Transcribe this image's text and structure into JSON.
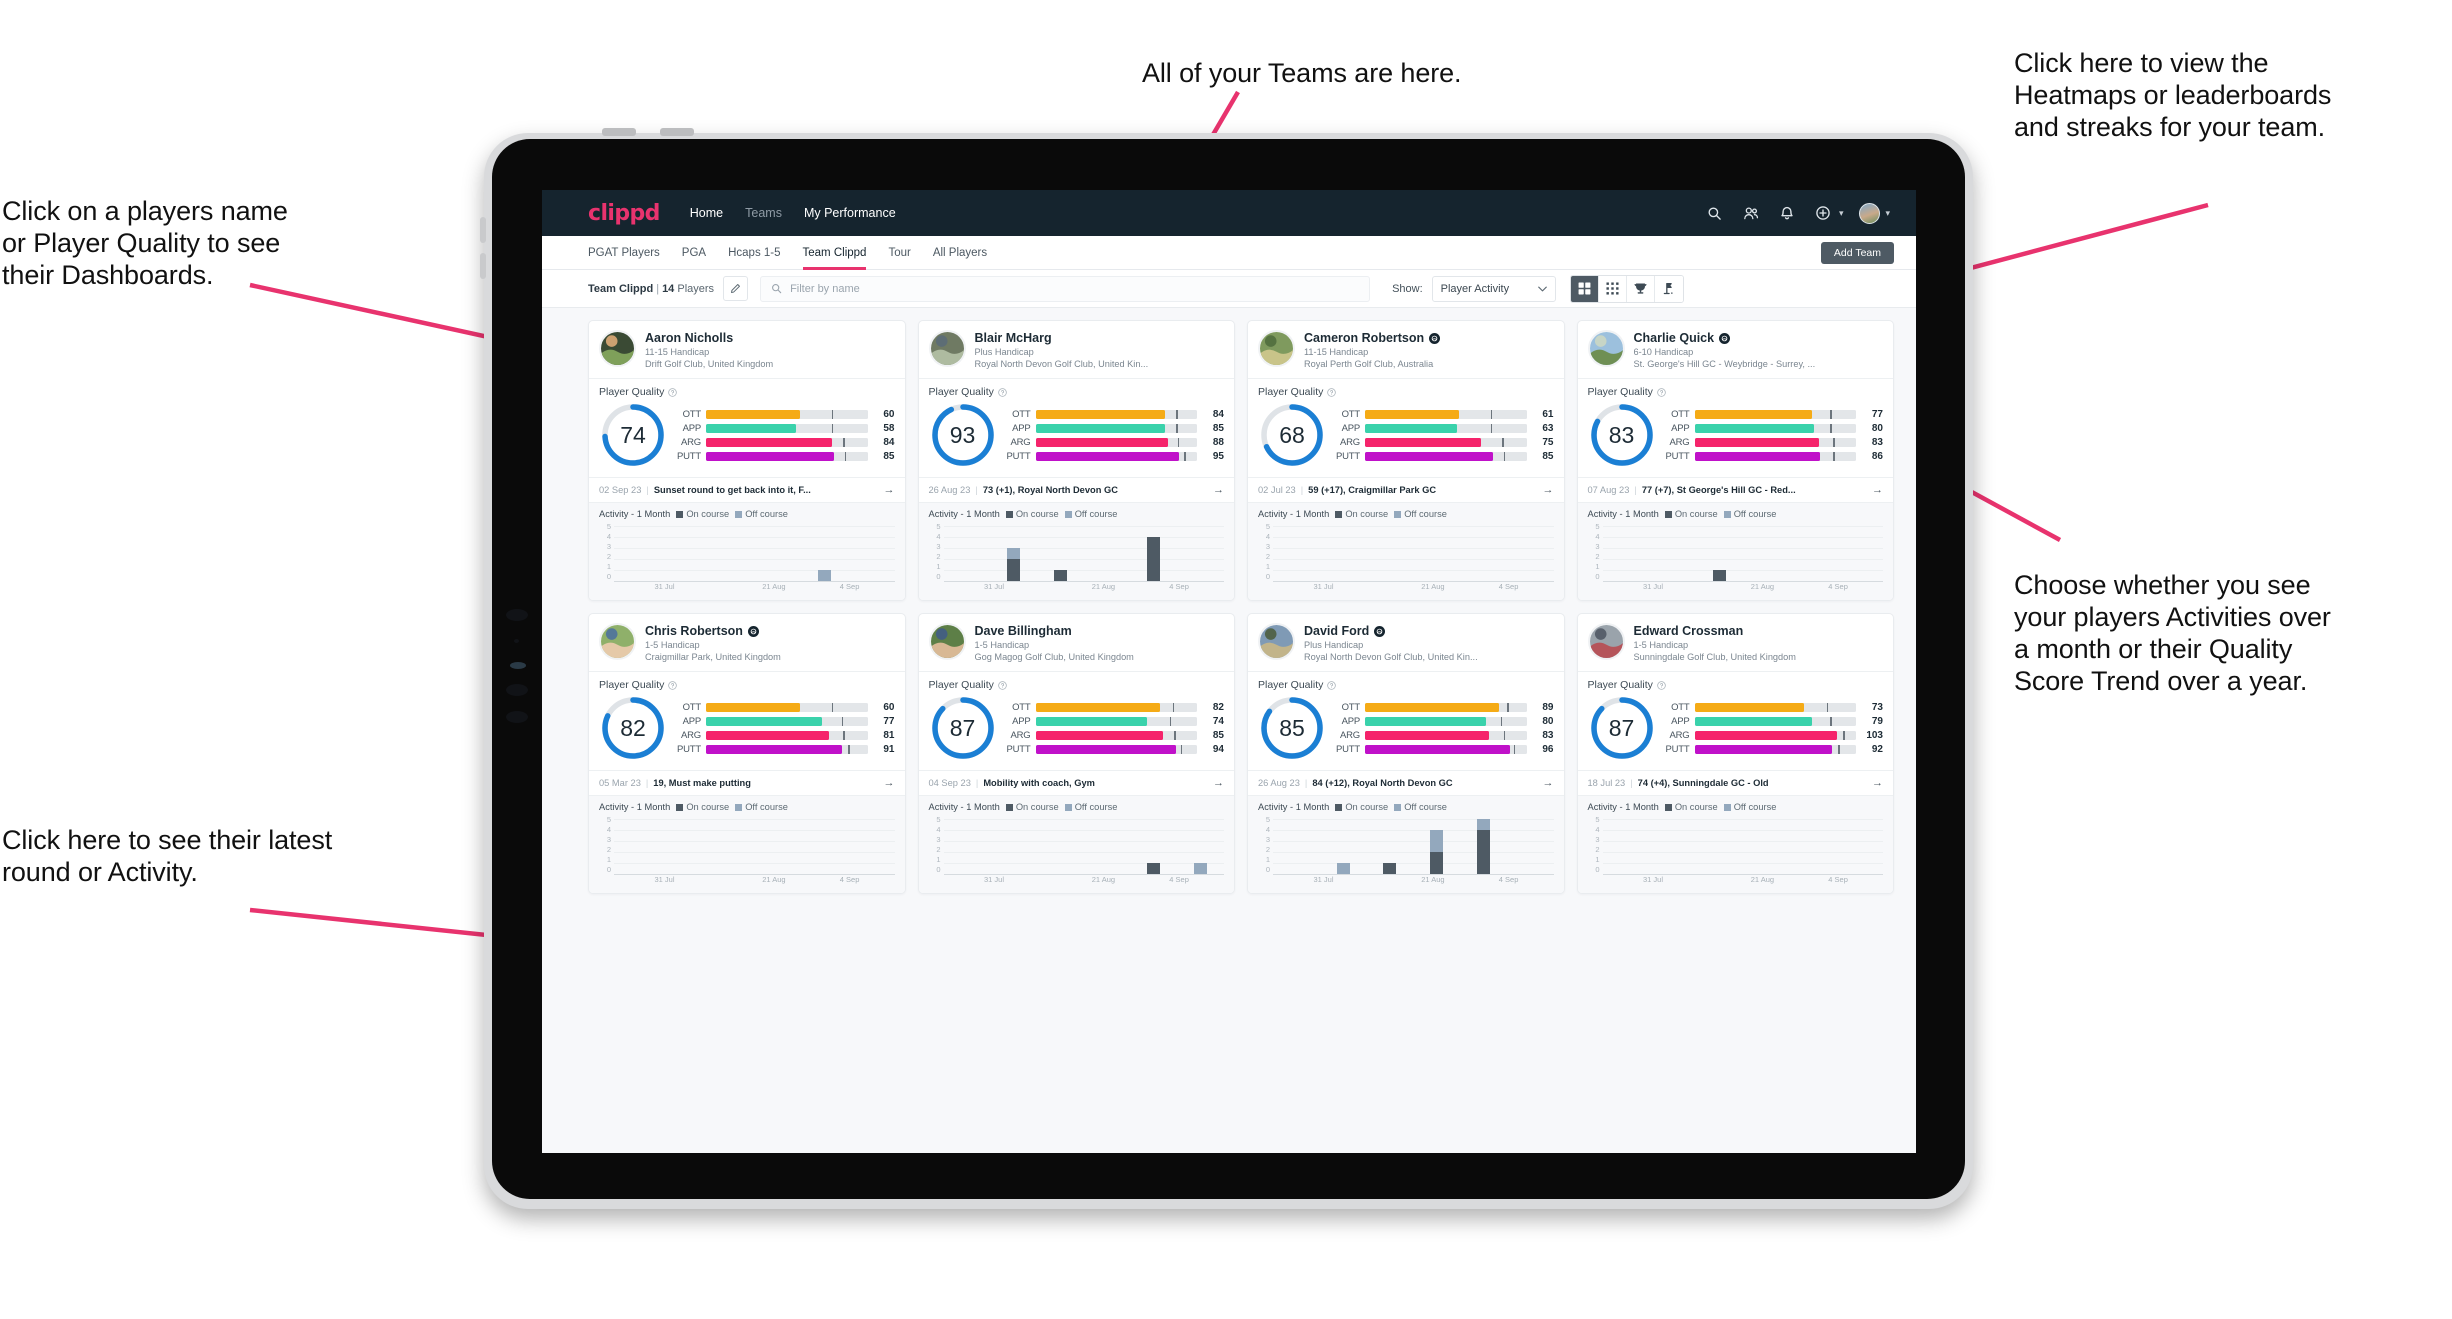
{
  "annotations": [
    {
      "id": "teams",
      "text": "All of your Teams are here."
    },
    {
      "id": "heatmaps",
      "text": "Click here to view the\nHeatmaps or leaderboards\nand streaks for your team."
    },
    {
      "id": "dashboards",
      "text": "Click on a players name\nor Player Quality to see\ntheir Dashboards."
    },
    {
      "id": "activity-choice",
      "text": "Choose whether you see\nyour players Activities over\na month or their Quality\nScore Trend over a year."
    },
    {
      "id": "latest-round",
      "text": "Click here to see their latest\nround or Activity."
    }
  ],
  "accent_pink": "#e8336e",
  "navbar": {
    "brand": "clippd",
    "links": [
      {
        "label": "Home",
        "state": "active"
      },
      {
        "label": "Teams",
        "state": "dim"
      },
      {
        "label": "My Performance",
        "state": "active"
      }
    ],
    "icons": [
      "search-icon",
      "people-icon",
      "bell-icon",
      "plus-circle-icon",
      "avatar"
    ]
  },
  "tabs": {
    "items": [
      "PGAT Players",
      "PGA",
      "Hcaps 1-5",
      "Team Clippd",
      "Tour",
      "All Players"
    ],
    "selected": "Team Clippd",
    "add_team_label": "Add Team"
  },
  "filterbar": {
    "team_name": "Team Clippd",
    "separator": "|",
    "player_count": "14",
    "player_word": "Players",
    "edit_icon": "pencil-icon",
    "search_placeholder": "Filter by name",
    "show_label": "Show:",
    "show_value": "Player Activity",
    "view_modes": [
      {
        "name": "grid-view-icon",
        "active": true
      },
      {
        "name": "dense-grid-view-icon",
        "active": false
      },
      {
        "name": "trophy-view-icon",
        "active": false
      },
      {
        "name": "course-flag-view-icon",
        "active": false
      }
    ]
  },
  "card_labels": {
    "player_quality": "Player Quality",
    "help_icon": "help-circle-icon",
    "activity_title": "Activity - 1 Month",
    "legend_on": "On course",
    "legend_off": "Off course",
    "arrow": "→"
  },
  "metric_colors": {
    "OTT": "#f5ab16",
    "APP": "#3ad2ab",
    "ARG": "#f5236b",
    "PUTT": "#c011c9",
    "ring": "#1b7fd4",
    "ring_track": "#dfe3e7"
  },
  "chart_axes": {
    "y_ticks": [
      "5",
      "4",
      "3",
      "2",
      "1",
      "0"
    ],
    "y_max": 5,
    "x_ticks": [
      "31 Jul",
      "21 Aug",
      "4 Sep"
    ],
    "x_tick_pos": [
      18,
      57,
      84
    ]
  },
  "players": [
    {
      "name": "Aaron Nicholls",
      "verified": false,
      "handicap": "11-15 Handicap",
      "club": "Drift Golf Club, United Kingdom",
      "quality": 74,
      "metrics": [
        {
          "label": "OTT",
          "value": 60,
          "fill": 58,
          "tick": 78
        },
        {
          "label": "APP",
          "value": 58,
          "fill": 56,
          "tick": 78
        },
        {
          "label": "ARG",
          "value": 84,
          "fill": 78,
          "tick": 85
        },
        {
          "label": "PUTT",
          "value": 85,
          "fill": 79,
          "tick": 86
        }
      ],
      "last_date": "02 Sep 23",
      "last_text": "Sunset round to get back into it, F...",
      "activity": [
        {
          "on": 0,
          "off": 0
        },
        {
          "on": 0,
          "off": 0
        },
        {
          "on": 0,
          "off": 0
        },
        {
          "on": 0,
          "off": 0
        },
        {
          "on": 0,
          "off": 1
        },
        {
          "on": 0,
          "off": 0
        }
      ],
      "avatar_colors": [
        "#3a4a34",
        "#7fa05a",
        "#e8b07c"
      ]
    },
    {
      "name": "Blair McHarg",
      "verified": false,
      "handicap": "Plus Handicap",
      "club": "Royal North Devon Golf Club, United Kin...",
      "quality": 93,
      "metrics": [
        {
          "label": "OTT",
          "value": 84,
          "fill": 80,
          "tick": 87
        },
        {
          "label": "APP",
          "value": 85,
          "fill": 80,
          "tick": 87
        },
        {
          "label": "ARG",
          "value": 88,
          "fill": 82,
          "tick": 88
        },
        {
          "label": "PUTT",
          "value": 95,
          "fill": 89,
          "tick": 92
        }
      ],
      "last_date": "26 Aug 23",
      "last_text": "73 (+1), Royal North Devon GC",
      "activity": [
        {
          "on": 0,
          "off": 0
        },
        {
          "on": 2,
          "off": 1
        },
        {
          "on": 1,
          "off": 0
        },
        {
          "on": 0,
          "off": 0
        },
        {
          "on": 4,
          "off": 0
        },
        {
          "on": 0,
          "off": 0
        }
      ],
      "avatar_colors": [
        "#6f7a63",
        "#aebba0",
        "#5a6b78"
      ]
    },
    {
      "name": "Cameron Robertson",
      "verified": true,
      "handicap": "11-15 Handicap",
      "club": "Royal Perth Golf Club, Australia",
      "quality": 68,
      "metrics": [
        {
          "label": "OTT",
          "value": 61,
          "fill": 58,
          "tick": 78
        },
        {
          "label": "APP",
          "value": 63,
          "fill": 57,
          "tick": 78
        },
        {
          "label": "ARG",
          "value": 75,
          "fill": 72,
          "tick": 85
        },
        {
          "label": "PUTT",
          "value": 85,
          "fill": 79,
          "tick": 86
        }
      ],
      "last_date": "02 Jul 23",
      "last_text": "59 (+17), Craigmillar Park GC",
      "activity": [
        {
          "on": 0,
          "off": 0
        },
        {
          "on": 0,
          "off": 0
        },
        {
          "on": 0,
          "off": 0
        },
        {
          "on": 0,
          "off": 0
        },
        {
          "on": 0,
          "off": 0
        },
        {
          "on": 0,
          "off": 0
        }
      ],
      "avatar_colors": [
        "#7f9a5e",
        "#c9c489",
        "#4e6b3c"
      ]
    },
    {
      "name": "Charlie Quick",
      "verified": true,
      "handicap": "6-10 Handicap",
      "club": "St. George's Hill GC - Weybridge - Surrey, ...",
      "quality": 83,
      "metrics": [
        {
          "label": "OTT",
          "value": 77,
          "fill": 73,
          "tick": 84
        },
        {
          "label": "APP",
          "value": 80,
          "fill": 74,
          "tick": 84
        },
        {
          "label": "ARG",
          "value": 83,
          "fill": 77,
          "tick": 86
        },
        {
          "label": "PUTT",
          "value": 86,
          "fill": 78,
          "tick": 86
        }
      ],
      "last_date": "07 Aug 23",
      "last_text": "77 (+7), St George's Hill GC - Red...",
      "activity": [
        {
          "on": 0,
          "off": 0
        },
        {
          "on": 0,
          "off": 0
        },
        {
          "on": 1,
          "off": 0
        },
        {
          "on": 0,
          "off": 0
        },
        {
          "on": 0,
          "off": 0
        },
        {
          "on": 0,
          "off": 0
        }
      ],
      "avatar_colors": [
        "#9cc0dd",
        "#6f8f54",
        "#cfd8c2"
      ]
    },
    {
      "name": "Chris Robertson",
      "verified": true,
      "handicap": "1-5 Handicap",
      "club": "Craigmillar Park, United Kingdom",
      "quality": 82,
      "metrics": [
        {
          "label": "OTT",
          "value": 60,
          "fill": 58,
          "tick": 78
        },
        {
          "label": "APP",
          "value": 77,
          "fill": 72,
          "tick": 84
        },
        {
          "label": "ARG",
          "value": 81,
          "fill": 76,
          "tick": 85
        },
        {
          "label": "PUTT",
          "value": 91,
          "fill": 84,
          "tick": 88
        }
      ],
      "last_date": "05 Mar 23",
      "last_text": "19, Must make putting",
      "activity": [
        {
          "on": 0,
          "off": 0
        },
        {
          "on": 0,
          "off": 0
        },
        {
          "on": 0,
          "off": 0
        },
        {
          "on": 0,
          "off": 0
        },
        {
          "on": 0,
          "off": 0
        },
        {
          "on": 0,
          "off": 0
        }
      ],
      "avatar_colors": [
        "#8fb06a",
        "#e5c9a8",
        "#4a6fa0"
      ]
    },
    {
      "name": "Dave Billingham",
      "verified": false,
      "handicap": "1-5 Handicap",
      "club": "Gog Magog Golf Club, United Kingdom",
      "quality": 87,
      "metrics": [
        {
          "label": "OTT",
          "value": 82,
          "fill": 77,
          "tick": 85
        },
        {
          "label": "APP",
          "value": 74,
          "fill": 69,
          "tick": 83
        },
        {
          "label": "ARG",
          "value": 85,
          "fill": 79,
          "tick": 86
        },
        {
          "label": "PUTT",
          "value": 94,
          "fill": 87,
          "tick": 90
        }
      ],
      "last_date": "04 Sep 23",
      "last_text": "Mobility with coach, Gym",
      "activity": [
        {
          "on": 0,
          "off": 0
        },
        {
          "on": 0,
          "off": 0
        },
        {
          "on": 0,
          "off": 0
        },
        {
          "on": 0,
          "off": 0
        },
        {
          "on": 1,
          "off": 0
        },
        {
          "on": 0,
          "off": 1
        }
      ],
      "avatar_colors": [
        "#5d7f47",
        "#d8b894",
        "#3f5a8a"
      ]
    },
    {
      "name": "David Ford",
      "verified": true,
      "handicap": "Plus Handicap",
      "club": "Royal North Devon Golf Club, United Kin...",
      "quality": 85,
      "metrics": [
        {
          "label": "OTT",
          "value": 89,
          "fill": 83,
          "tick": 88
        },
        {
          "label": "APP",
          "value": 80,
          "fill": 75,
          "tick": 84
        },
        {
          "label": "ARG",
          "value": 83,
          "fill": 77,
          "tick": 86
        },
        {
          "label": "PUTT",
          "value": 96,
          "fill": 90,
          "tick": 92
        }
      ],
      "last_date": "26 Aug 23",
      "last_text": "84 (+12), Royal North Devon GC",
      "activity": [
        {
          "on": 0,
          "off": 0
        },
        {
          "on": 0,
          "off": 1
        },
        {
          "on": 1,
          "off": 0
        },
        {
          "on": 2,
          "off": 2
        },
        {
          "on": 4,
          "off": 1
        },
        {
          "on": 0,
          "off": 0
        }
      ],
      "avatar_colors": [
        "#7f9ab5",
        "#c2b48a",
        "#4a5a3a"
      ]
    },
    {
      "name": "Edward Crossman",
      "verified": false,
      "handicap": "1-5 Handicap",
      "club": "Sunningdale Golf Club, United Kingdom",
      "quality": 87,
      "metrics": [
        {
          "label": "OTT",
          "value": 73,
          "fill": 68,
          "tick": 82
        },
        {
          "label": "APP",
          "value": 79,
          "fill": 73,
          "tick": 84
        },
        {
          "label": "ARG",
          "value": 103,
          "fill": 88,
          "tick": 92
        },
        {
          "label": "PUTT",
          "value": 92,
          "fill": 85,
          "tick": 89
        }
      ],
      "last_date": "18 Jul 23",
      "last_text": "74 (+4), Sunningdale GC - Old",
      "activity": [
        {
          "on": 0,
          "off": 0
        },
        {
          "on": 0,
          "off": 0
        },
        {
          "on": 0,
          "off": 0
        },
        {
          "on": 0,
          "off": 0
        },
        {
          "on": 0,
          "off": 0
        },
        {
          "on": 0,
          "off": 0
        }
      ],
      "avatar_colors": [
        "#9aa3ab",
        "#b5545a",
        "#4c5560"
      ]
    }
  ]
}
